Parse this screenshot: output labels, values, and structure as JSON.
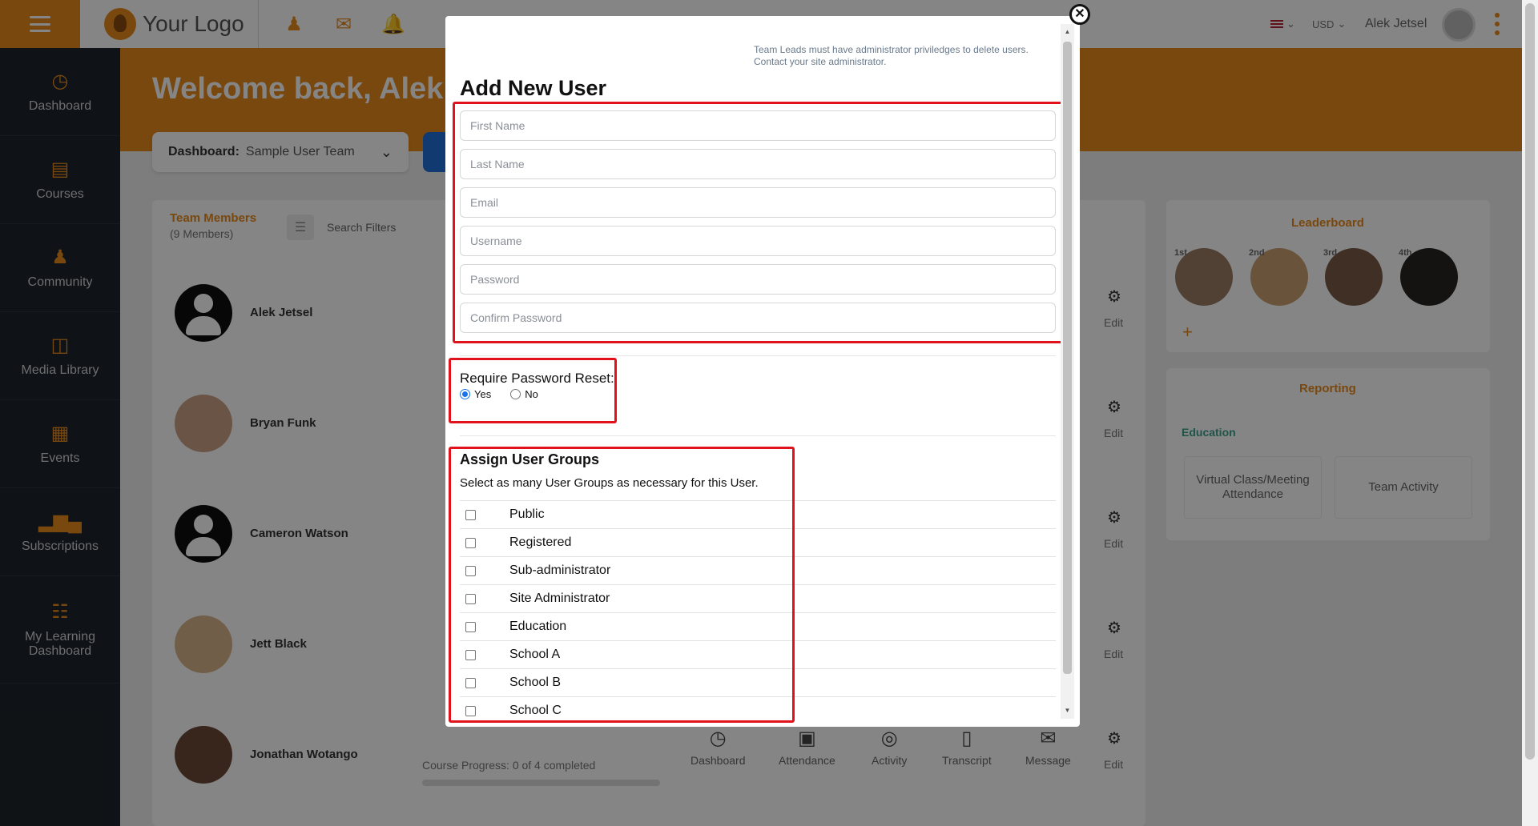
{
  "app": {
    "logo_text": "Your Logo",
    "currency": "USD",
    "user_name": "Alek Jetsel",
    "welcome": "Welcome back, Alek",
    "dashboard_label": "Dashboard:",
    "dashboard_value": "Sample User Team",
    "brand_color": "#e88a1e"
  },
  "sidebar": {
    "items": [
      {
        "label": "Dashboard",
        "icon": "gauge-icon"
      },
      {
        "label": "Courses",
        "icon": "books-icon"
      },
      {
        "label": "Community",
        "icon": "people-icon"
      },
      {
        "label": "Media Library",
        "icon": "film-icon"
      },
      {
        "label": "Events",
        "icon": "calendar-icon"
      },
      {
        "label": "Subscriptions",
        "icon": "bar-chart-icon"
      },
      {
        "label": "My Learning Dashboard",
        "icon": "open-book-icon"
      }
    ]
  },
  "team": {
    "title": "Team Members",
    "count": "(9 Members)",
    "filters_label": "Search Filters",
    "members": [
      "Alek Jetsel",
      "Bryan Funk",
      "Cameron Watson",
      "Jett Black",
      "Jonathan Wotango"
    ],
    "course_progress": "Course Progress: 0 of 4 completed",
    "edit_label": "Edit",
    "actions": [
      "Dashboard",
      "Attendance",
      "Activity",
      "Transcript",
      "Message"
    ]
  },
  "leaderboard": {
    "title": "Leaderboard",
    "ranks": [
      "1st",
      "2nd",
      "3rd",
      "4th"
    ]
  },
  "reporting": {
    "title": "Reporting",
    "category": "Education",
    "cards": [
      "Virtual Class/Meeting Attendance",
      "Team Activity"
    ]
  },
  "modal": {
    "notice": "Team Leads must have administrator priviledges to delete users. Contact your site administrator.",
    "title": "Add New User",
    "fields": {
      "first_name": "First Name",
      "last_name": "Last Name",
      "email": "Email",
      "username": "Username",
      "password": "Password",
      "confirm_password": "Confirm Password"
    },
    "password_reset": {
      "label": "Require Password Reset:",
      "options": [
        "Yes",
        "No"
      ],
      "selected": "Yes"
    },
    "groups": {
      "title": "Assign User Groups",
      "description": "Select as many User Groups as necessary for this User.",
      "items": [
        "Public",
        "Registered",
        "Sub-administrator",
        "Site Administrator",
        "Education",
        "School A",
        "School B",
        "School C"
      ]
    },
    "highlight_color": "#e0121c"
  }
}
